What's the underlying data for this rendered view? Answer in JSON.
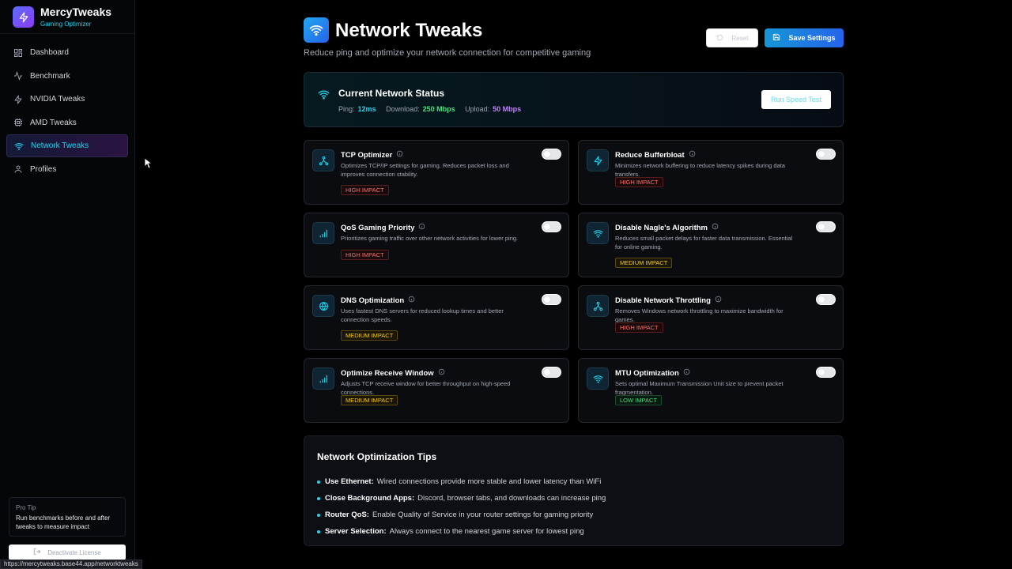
{
  "brand": {
    "name": "MercyTweaks",
    "subtitle": "Gaming Optimizer"
  },
  "sidebar": {
    "items": [
      {
        "label": "Dashboard",
        "icon": "grid-icon"
      },
      {
        "label": "Benchmark",
        "icon": "activity-icon"
      },
      {
        "label": "NVIDIA Tweaks",
        "icon": "bolt-icon"
      },
      {
        "label": "AMD Tweaks",
        "icon": "chip-icon"
      },
      {
        "label": "Network Tweaks",
        "icon": "wifi-icon",
        "active": true
      },
      {
        "label": "Profiles",
        "icon": "user-icon"
      }
    ],
    "protip": {
      "title": "Pro Tip",
      "body": "Run benchmarks before and after tweaks to measure impact"
    },
    "deactivate_label": "Deactivate License"
  },
  "header": {
    "title": "Network Tweaks",
    "subtitle": "Reduce ping and optimize your network connection for competitive gaming",
    "reset_label": "Reset",
    "save_label": "Save Settings"
  },
  "status": {
    "title": "Current Network Status",
    "ping_label": "Ping:",
    "ping_value": "12ms",
    "download_label": "Download:",
    "download_value": "250 Mbps",
    "upload_label": "Upload:",
    "upload_value": "50 Mbps",
    "speed_test_label": "Run Speed Test"
  },
  "tweaks": [
    {
      "title": "TCP Optimizer",
      "desc": "Optimizes TCP/IP settings for gaming. Reduces packet loss and improves connection stability.",
      "impact": "HIGH IMPACT",
      "level": "high",
      "icon": "network-icon",
      "enabled": false
    },
    {
      "title": "Reduce Bufferbloat",
      "desc": "Minimizes network buffering to reduce latency spikes during data transfers.",
      "impact": "HIGH IMPACT",
      "level": "high",
      "icon": "bolt-icon",
      "enabled": false
    },
    {
      "title": "QoS Gaming Priority",
      "desc": "Prioritizes gaming traffic over other network activities for lower ping.",
      "impact": "HIGH IMPACT",
      "level": "high",
      "icon": "signal-icon",
      "enabled": false
    },
    {
      "title": "Disable Nagle's Algorithm",
      "desc": "Reduces small packet delays for faster data transmission. Essential for online gaming.",
      "impact": "MEDIUM IMPACT",
      "level": "medium",
      "icon": "wifi-icon",
      "enabled": false
    },
    {
      "title": "DNS Optimization",
      "desc": "Uses fastest DNS servers for reduced lookup times and better connection speeds.",
      "impact": "MEDIUM IMPACT",
      "level": "medium",
      "icon": "globe-icon",
      "enabled": false
    },
    {
      "title": "Disable Network Throttling",
      "desc": "Removes Windows network throttling to maximize bandwidth for games.",
      "impact": "HIGH IMPACT",
      "level": "high",
      "icon": "network-icon",
      "enabled": false
    },
    {
      "title": "Optimize Receive Window",
      "desc": "Adjusts TCP receive window for better throughput on high-speed connections.",
      "impact": "MEDIUM IMPACT",
      "level": "medium",
      "icon": "signal-icon",
      "enabled": false
    },
    {
      "title": "MTU Optimization",
      "desc": "Sets optimal Maximum Transmission Unit size to prevent packet fragmentation.",
      "impact": "LOW IMPACT",
      "level": "low",
      "icon": "wifi-icon",
      "enabled": false
    }
  ],
  "tips": {
    "title": "Network Optimization Tips",
    "items": [
      {
        "label": "Use Ethernet:",
        "text": "Wired connections provide more stable and lower latency than WiFi"
      },
      {
        "label": "Close Background Apps:",
        "text": "Discord, browser tabs, and downloads can increase ping"
      },
      {
        "label": "Router QoS:",
        "text": "Enable Quality of Service in your router settings for gaming priority"
      },
      {
        "label": "Server Selection:",
        "text": "Always connect to the nearest game server for lowest ping"
      }
    ]
  },
  "status_url": "https://mercytweaks.base44.app/networktweaks",
  "colors": {
    "accent": "#22d3ee",
    "brand": "#6366f1",
    "save": "#1d8fe0",
    "high": "#f87171",
    "medium": "#facc15",
    "low": "#4ade80"
  }
}
